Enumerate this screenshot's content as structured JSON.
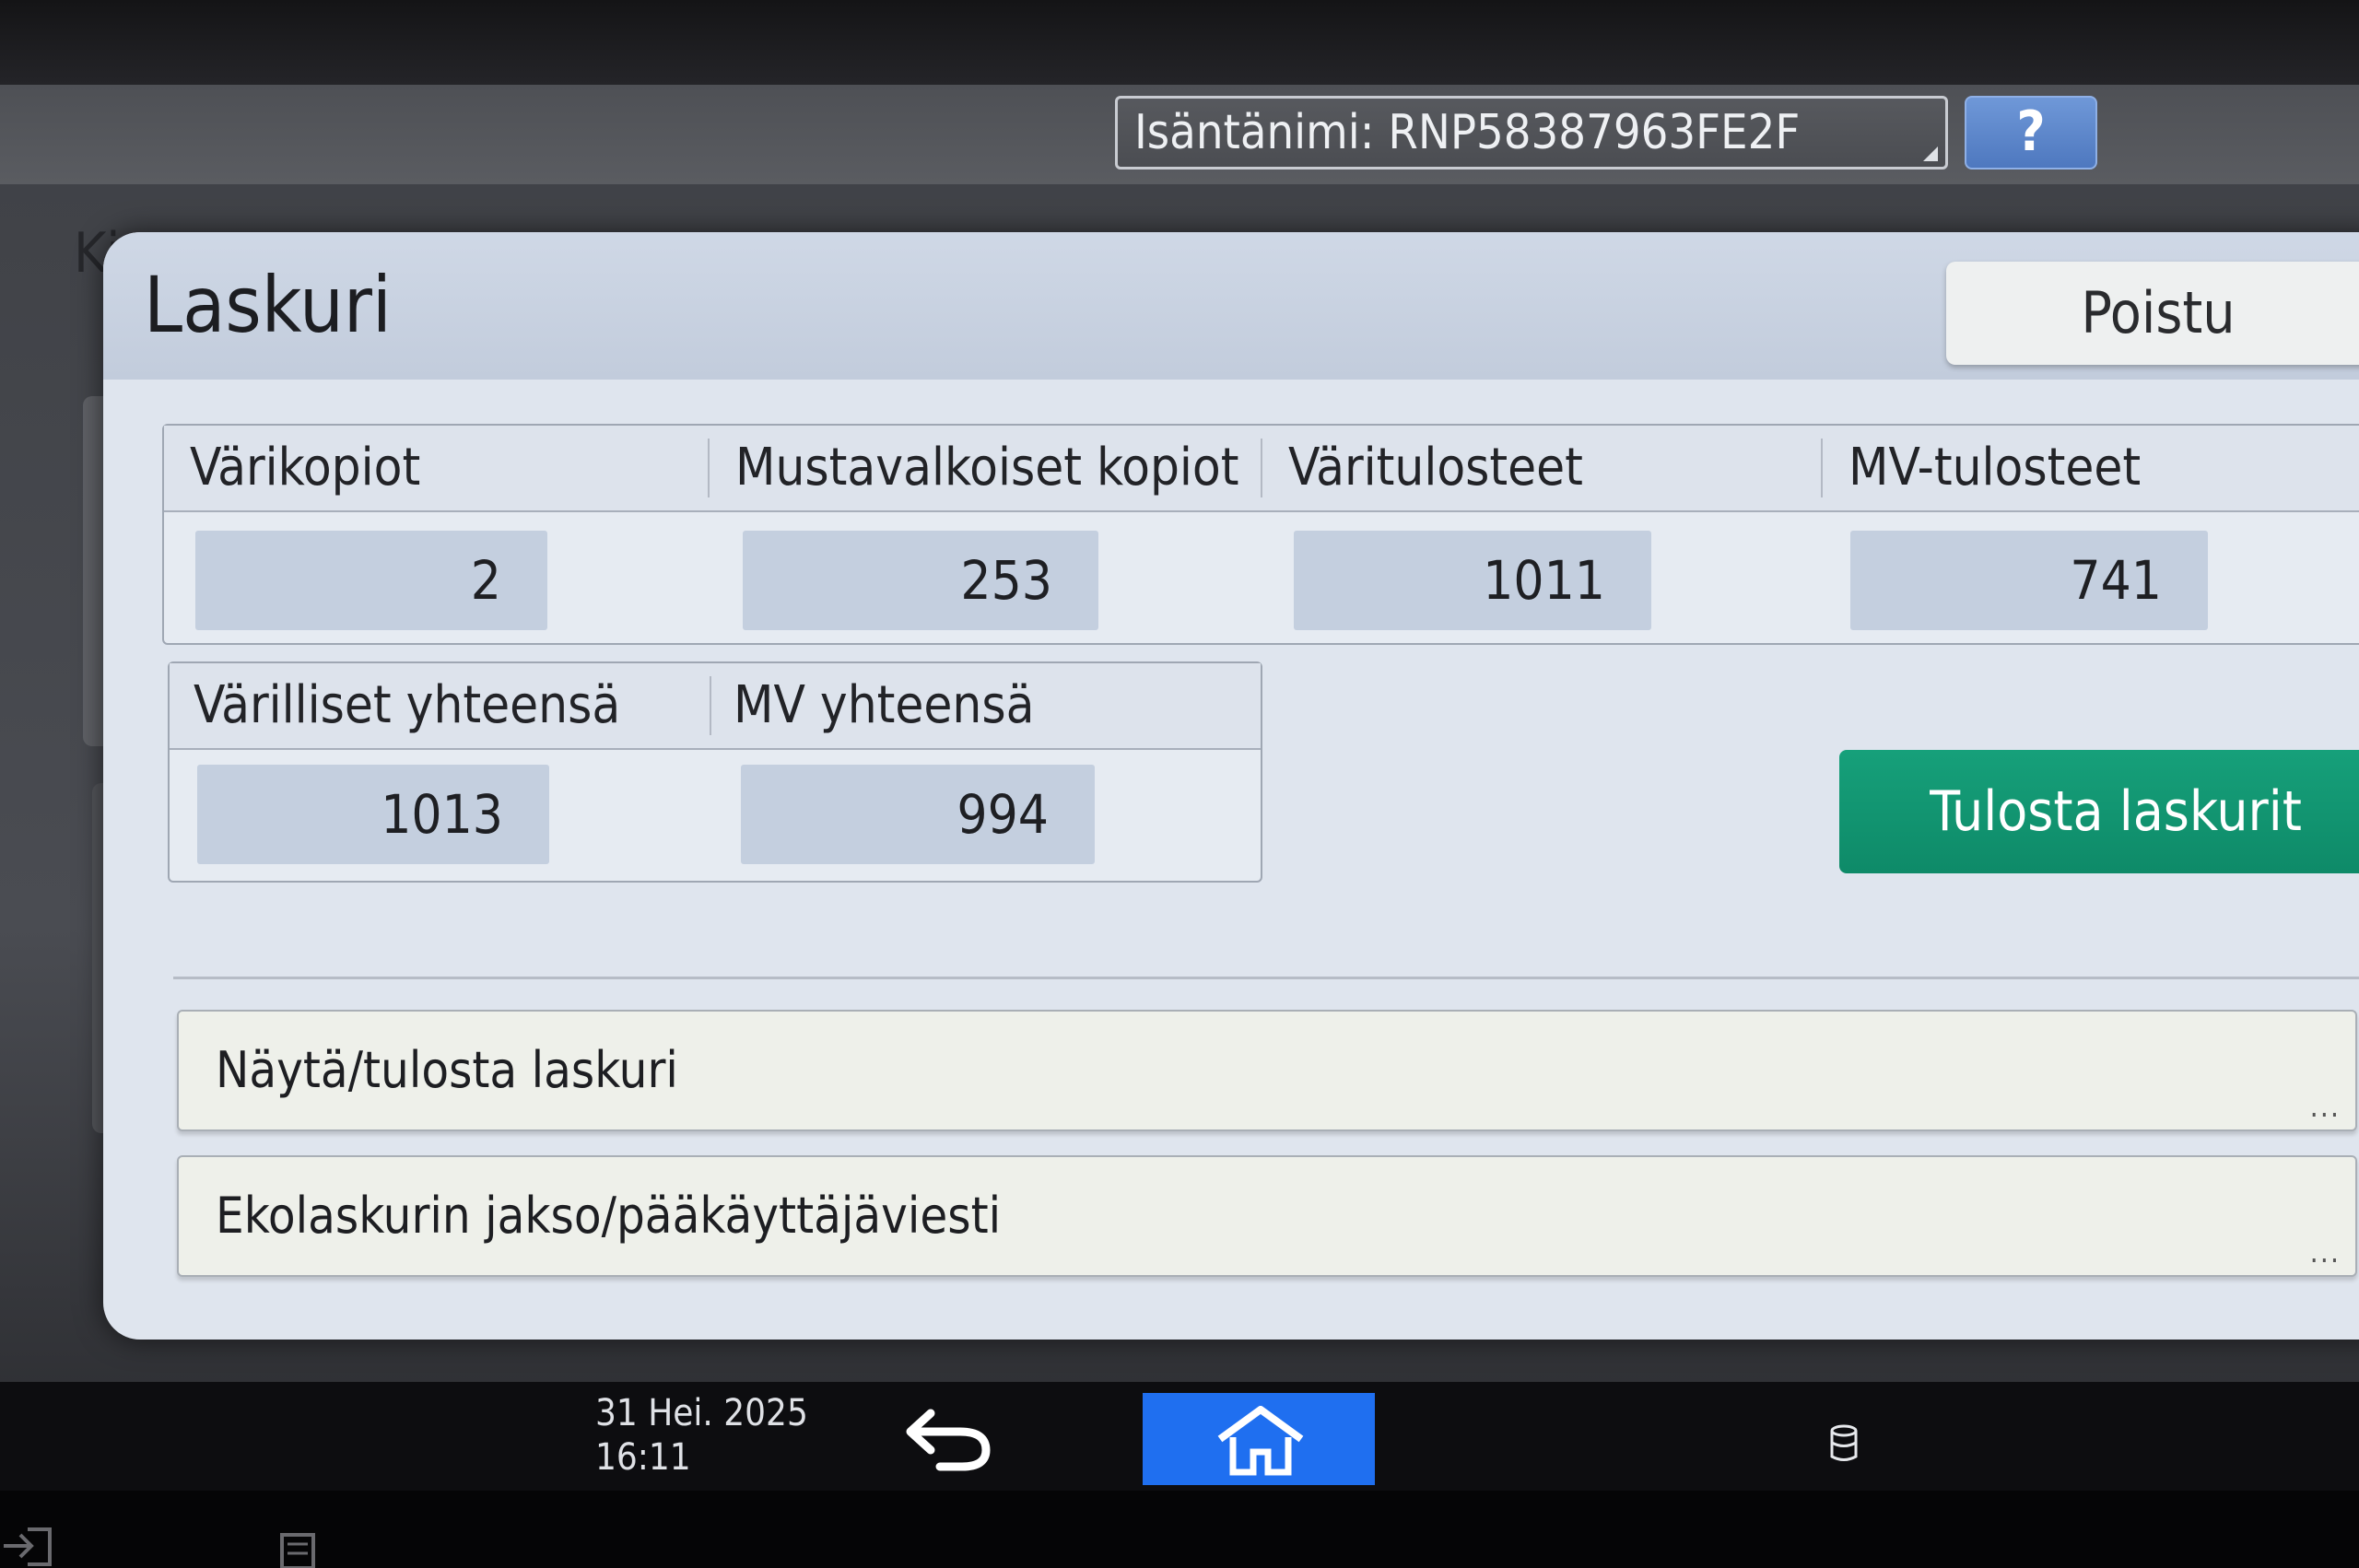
{
  "header": {
    "hostname": "Isäntänimi: RNP58387963FE2F",
    "help_label": "?"
  },
  "background": {
    "title": "Ki"
  },
  "dialog": {
    "title": "Laskuri",
    "exit_label": "Poistu",
    "counters_top": [
      {
        "label": "Värikopiot",
        "value": "2"
      },
      {
        "label": "Mustavalkoiset kopiot",
        "value": "253"
      },
      {
        "label": "Väritulosteet",
        "value": "1011"
      },
      {
        "label": "MV-tulosteet",
        "value": "741"
      }
    ],
    "counters_totals": [
      {
        "label": "Värilliset yhteensä",
        "value": "1013"
      },
      {
        "label": "MV yhteensä",
        "value": "994"
      }
    ],
    "print_counters_label": "Tulosta laskurit",
    "list_items": [
      {
        "label": "Näytä/tulosta laskuri",
        "more": "..."
      },
      {
        "label": "Ekolaskurin jakso/pääkäyttäjäviesti",
        "more": "..."
      }
    ]
  },
  "footer": {
    "date": "31 Hei. 2025",
    "time": "16:11"
  },
  "colors": {
    "accent_green": "#0e8a68",
    "home_blue": "#1f6ff0",
    "help_blue": "#4e78bf"
  },
  "icons": [
    "help-icon",
    "back-icon",
    "home-icon",
    "storage-icon",
    "login-icon",
    "document-icon",
    "more-icon"
  ]
}
